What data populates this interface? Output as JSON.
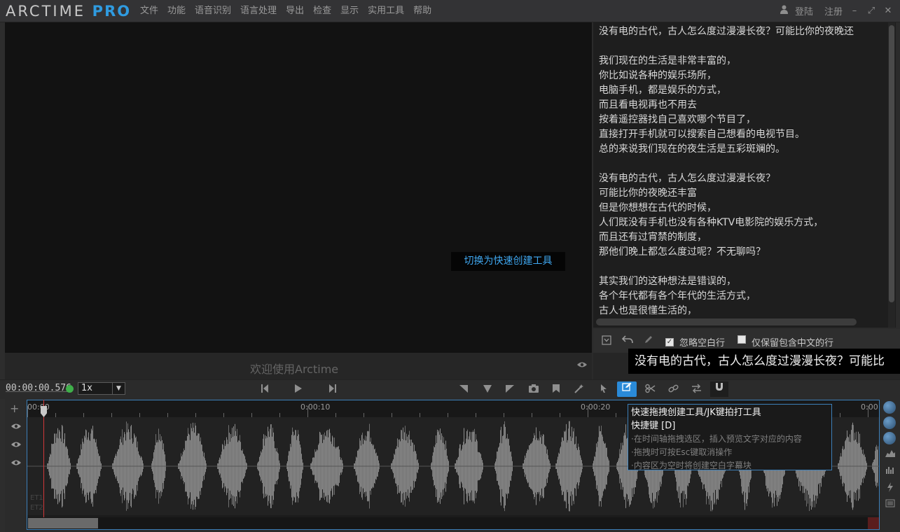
{
  "app": {
    "logo_main": "ARCTIME",
    "logo_pro": "PRO",
    "menus": [
      "文件",
      "功能",
      "语音识别",
      "语言处理",
      "导出",
      "检查",
      "显示",
      "实用工具",
      "帮助"
    ],
    "login": "登陆",
    "register": "注册"
  },
  "video": {
    "quick_tool_hint": "切换为快速创建工具",
    "welcome": "欢迎使用Arctime"
  },
  "text_panel": {
    "lines": [
      "没有电的古代，古人怎么度过漫漫长夜？可能比你的夜晚还",
      "",
      "我们现在的生活是非常丰富的，",
      "你比如说各种的娱乐场所，",
      "电脑手机，都是娱乐的方式，",
      "而且看电视再也不用去",
      "按着遥控器找自己喜欢哪个节目了，",
      "直接打开手机就可以搜索自己想看的电视节目。",
      "总的来说我们现在的夜生活是五彩斑斓的。",
      "",
      "没有电的古代，古人怎么度过漫漫长夜？",
      "可能比你的夜晚还丰富",
      "但是你想想在古代的时候，",
      "人们既没有手机也没有各种KTV电影院的娱乐方式，",
      "而且还有过宵禁的制度，",
      "那他们晚上都怎么度过呢？不无聊吗？",
      "",
      "其实我们的这种想法是错误的，",
      "各个年代都有各个年代的生活方式，",
      "古人也是很懂生活的，"
    ],
    "ignore_blank": "忽略空白行",
    "keep_chinese": "仅保留包含中文的行",
    "subtitle_preview": "没有电的古代，古人怎么度过漫漫长夜？可能比"
  },
  "controls": {
    "timecode": "00:00:00.576",
    "speed": "1x"
  },
  "timeline": {
    "ticks": [
      "00:00",
      "0:00:10",
      "0:00:20",
      "0:00:"
    ],
    "track_labels": [
      "ET1",
      "ET2"
    ]
  },
  "tooltip": {
    "title": "快速拖拽创建工具/JK键拍打工具",
    "shortcut": "快捷键 [D]",
    "tips": [
      "·在时间轴拖拽选区，插入预览文字对应的内容",
      "·拖拽时可按Esc键取消操作",
      "·内容区为空时将创建空白字幕块"
    ]
  },
  "colors": {
    "accent": "#2f9be0",
    "playhead": "#d0383a",
    "status_ok": "#3fb04a"
  }
}
